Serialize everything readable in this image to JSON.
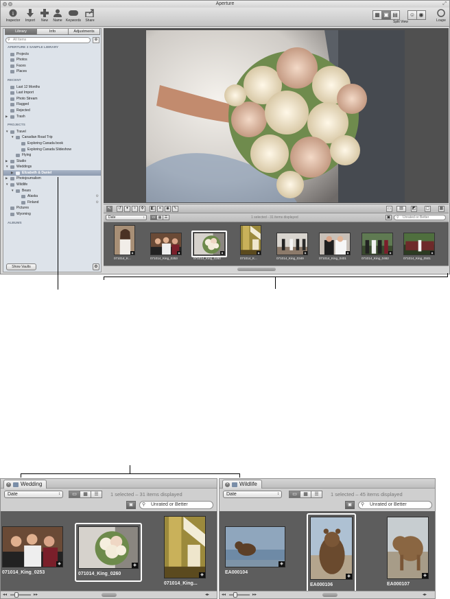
{
  "window": {
    "title": "Aperture"
  },
  "toolbar": {
    "buttons": [
      {
        "label": "Inspector"
      },
      {
        "label": "Import"
      },
      {
        "label": "New"
      },
      {
        "label": "Name"
      },
      {
        "label": "Keywords"
      },
      {
        "label": "Share"
      }
    ],
    "split_view_label": "Split View",
    "loupe_label": "Loupe"
  },
  "inspector": {
    "tabs": [
      "Library",
      "Info",
      "Adjustments"
    ],
    "search_placeholder": "All Items",
    "rows": [
      {
        "kind": "header",
        "label": "APERTURE 3 SAMPLE LIBRARY"
      },
      {
        "label": "Projects",
        "indent": 0
      },
      {
        "label": "Photos",
        "indent": 0
      },
      {
        "label": "Faces",
        "indent": 0
      },
      {
        "label": "Places",
        "indent": 0
      },
      {
        "kind": "spacer"
      },
      {
        "kind": "header",
        "label": "RECENT"
      },
      {
        "label": "Last 12 Months",
        "indent": 0
      },
      {
        "label": "Last Import",
        "indent": 0
      },
      {
        "label": "Photo Stream",
        "indent": 0
      },
      {
        "label": "Flagged",
        "indent": 0
      },
      {
        "label": "Rejected",
        "indent": 0
      },
      {
        "label": "Trash",
        "indent": 0,
        "tri": "▶"
      },
      {
        "kind": "spacer"
      },
      {
        "kind": "header",
        "label": "PROJECTS"
      },
      {
        "label": "Travel",
        "indent": 0,
        "tri": "▼"
      },
      {
        "label": "Canadian Road Trip",
        "indent": 1,
        "tri": "▼"
      },
      {
        "label": "Exploring Canada book",
        "indent": 2
      },
      {
        "label": "Exploring Canada Slideshow",
        "indent": 2
      },
      {
        "label": "Flying",
        "indent": 1
      },
      {
        "label": "Studio",
        "indent": 0,
        "tri": "▶"
      },
      {
        "label": "Weddings",
        "indent": 0,
        "tri": "▼"
      },
      {
        "label": "Elizabeth & Daniel",
        "indent": 1,
        "tri": "▶",
        "selected": true
      },
      {
        "label": "Photojournalism",
        "indent": 0,
        "tri": "▶"
      },
      {
        "label": "Wildlife",
        "indent": 0,
        "tri": "▼"
      },
      {
        "label": "Bears",
        "indent": 1,
        "tri": "▼"
      },
      {
        "label": "Alaska",
        "indent": 2,
        "gear": true
      },
      {
        "label": "Finland",
        "indent": 2,
        "gear": true
      },
      {
        "label": "Pictures",
        "indent": 0
      },
      {
        "label": "Wyoming",
        "indent": 0
      },
      {
        "kind": "spacer"
      },
      {
        "kind": "header",
        "label": "ALBUMS"
      }
    ],
    "show_vaults_label": "Show Vaults"
  },
  "browser": {
    "sort_value": "Date",
    "status": "1 selected - 31 items displayed",
    "filter_placeholder": "Unrated or Better",
    "thumbs": [
      {
        "caption": "071014_K...",
        "type": "portrait-bride"
      },
      {
        "caption": "071014_King_0253",
        "type": "group"
      },
      {
        "caption": "071014_King_0260",
        "type": "bouquet",
        "selected": true
      },
      {
        "caption": "071014_K...",
        "type": "stairs"
      },
      {
        "caption": "071014_King_0349",
        "type": "ceremony"
      },
      {
        "caption": "071014_King_0401",
        "type": "couple"
      },
      {
        "caption": "071014_King_0462",
        "type": "group2"
      },
      {
        "caption": "071014_King_0501",
        "type": "party"
      }
    ]
  },
  "split": {
    "left": {
      "tab": "Wedding",
      "sort_value": "Date",
      "status": "1 selected – 31 items displayed",
      "filter_placeholder": "Unrated or Better",
      "thumbs": [
        {
          "caption": "071014_King_0253",
          "type": "group"
        },
        {
          "caption": "071014_King_0260",
          "type": "bouquet",
          "selected": true
        },
        {
          "caption": "071014_King...",
          "type": "stairs"
        }
      ]
    },
    "right": {
      "tab": "Wildlife",
      "sort_value": "Date",
      "status": "1 selected – 45 items displayed",
      "filter_placeholder": "Unrated or Better",
      "thumbs": [
        {
          "caption": "EA000104",
          "type": "bear-water"
        },
        {
          "caption": "EA000106",
          "type": "bear-front",
          "selected": true
        },
        {
          "caption": "EA000107",
          "type": "bear-walk"
        }
      ]
    }
  },
  "colors": {
    "viewer_bg": "#505050",
    "filmstrip_bg": "#5d5d5d",
    "selection": "#8d9bb0"
  }
}
